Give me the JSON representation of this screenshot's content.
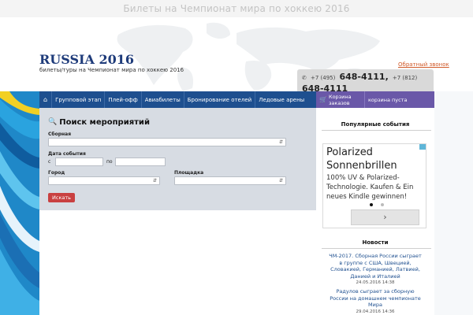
{
  "page": {
    "top_title": "Билеты на Чемпионат мира по хоккею 2016"
  },
  "header": {
    "logo_word": "Russia",
    "logo_year": "2016",
    "logo_subtitle": "билеты/туры на Чемпионат мира по хоккею 2016",
    "callback_link": "Обратный звонок",
    "phone1_code": "+7 (495)",
    "phone1_number": "648-4111",
    "phone2_code": "+7 (812)",
    "phone2_number": "648-4111",
    "phone_icon": "phone-icon"
  },
  "nav": {
    "home_icon": "home-icon",
    "items": [
      {
        "label": "Групповой этап"
      },
      {
        "label": "Плей-офф"
      },
      {
        "label": "Авиабилеты"
      },
      {
        "label": "Бронирование отелей"
      },
      {
        "label": "Ледовые арены"
      }
    ]
  },
  "cart": {
    "label": "Корзина заказов",
    "status": "корзина пуста",
    "icon": "cart-icon"
  },
  "search": {
    "title": "Поиск мероприятий",
    "team_label": "Сборная",
    "team_value": "",
    "date_label": "Дата события",
    "from_label": "с",
    "to_label": "по",
    "from_value": "",
    "to_value": "",
    "city_label": "Город",
    "city_value": "",
    "venue_label": "Площадка",
    "venue_value": "",
    "submit_label": "Искать"
  },
  "sidebar": {
    "popular_title": "Популярные события",
    "ad": {
      "title_line1": "Polarized",
      "title_line2": "Sonnenbrillen",
      "body": "100% UV & Polarized-Technologie. Kaufen & Ein neues Kindle gewinnen!",
      "next_glyph": "›"
    },
    "news_title": "Новости",
    "news": [
      {
        "text": "ЧМ-2017. Сборная России сыграет в группе с США, Швецией, Словакией, Германией, Латвией, Данией и Италией",
        "date": "24.05.2016 14:38"
      },
      {
        "text": "Радулов сыграет за сборную России на домашнем чемпионате Мира",
        "date": "29.04.2016 14:36"
      }
    ]
  },
  "colors": {
    "nav_blue": "#1e4f8f",
    "cart_purple": "#6a58a8",
    "panel_gray": "#d7dce3",
    "button_red": "#c94040",
    "link_blue": "#1e4f8f",
    "callback_orange": "#d05a2a"
  }
}
